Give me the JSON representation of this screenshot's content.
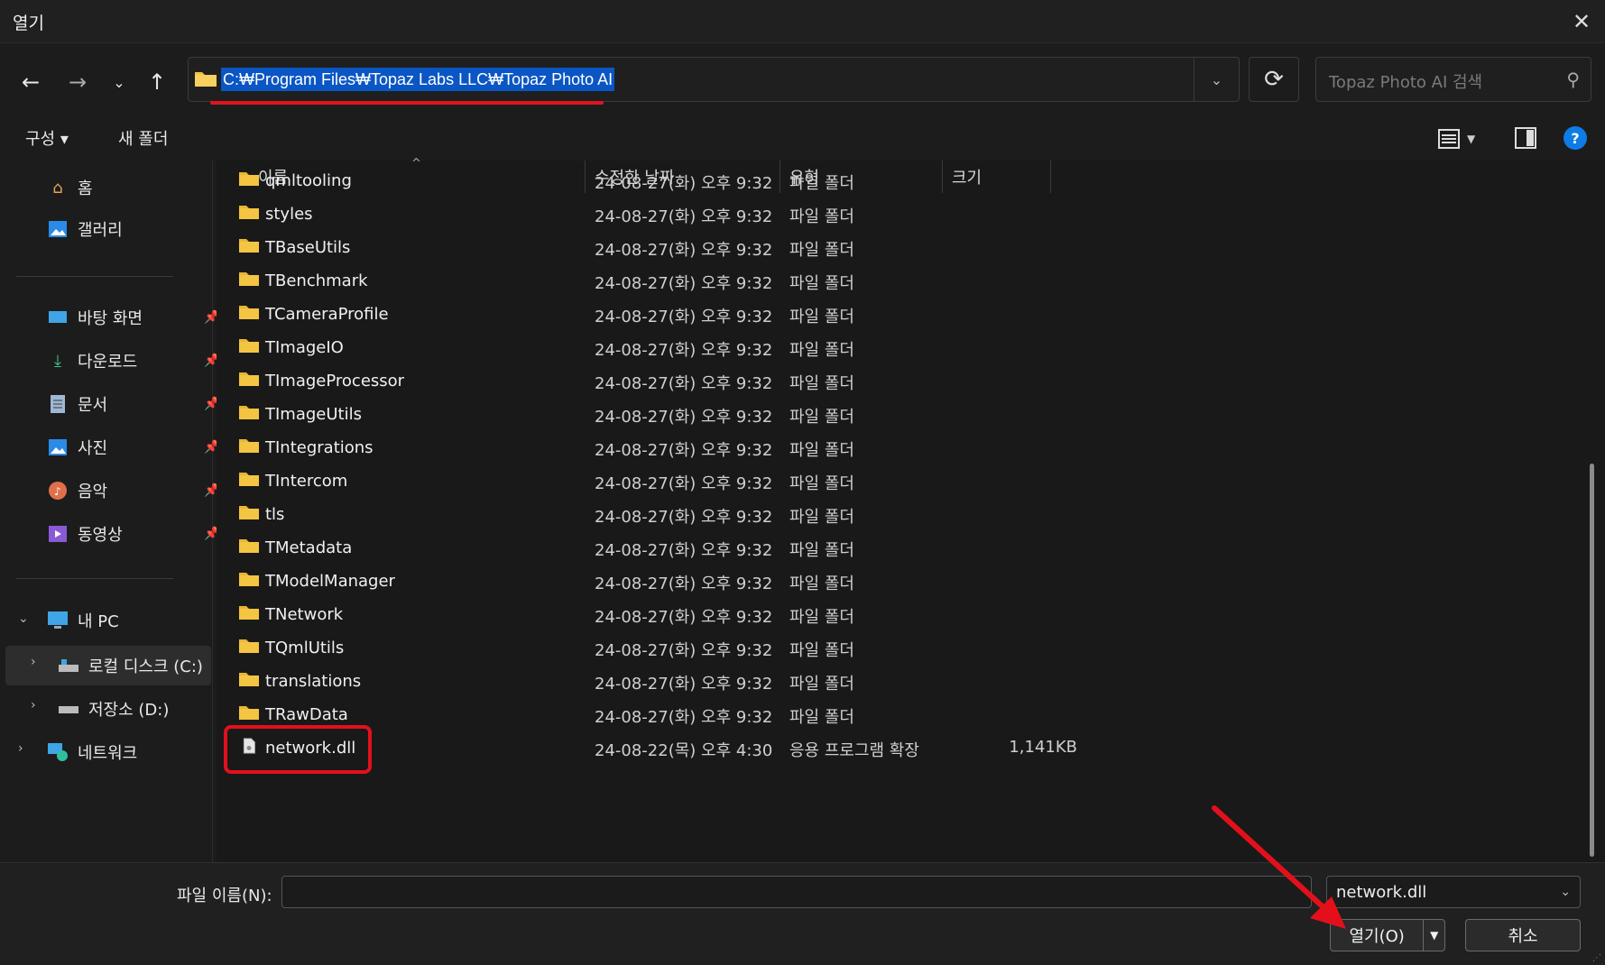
{
  "window": {
    "title": "열기"
  },
  "address": {
    "path": "C:₩Program Files₩Topaz Labs LLC₩Topaz Photo AI"
  },
  "search": {
    "placeholder": "Topaz Photo AI 검색"
  },
  "toolbar": {
    "organize_label": "구성 ▾",
    "new_folder_label": "새 폴더"
  },
  "sidebar": {
    "home": "홈",
    "gallery": "갤러리",
    "quick": [
      {
        "label": "바탕 화면"
      },
      {
        "label": "다운로드"
      },
      {
        "label": "문서"
      },
      {
        "label": "사진"
      },
      {
        "label": "음악"
      },
      {
        "label": "동영상"
      }
    ],
    "this_pc": "내 PC",
    "local_disk": "로컬 디스크 (C:)",
    "storage": "저장소 (D:)",
    "network": "네트워크"
  },
  "columns": {
    "name": "이름",
    "date": "수정한 날짜",
    "type": "유형",
    "size": "크기"
  },
  "files": [
    {
      "name": "qmltooling",
      "date": "24-08-27(화) 오후 9:32",
      "type": "파일 폴더",
      "size": ""
    },
    {
      "name": "styles",
      "date": "24-08-27(화) 오후 9:32",
      "type": "파일 폴더",
      "size": ""
    },
    {
      "name": "TBaseUtils",
      "date": "24-08-27(화) 오후 9:32",
      "type": "파일 폴더",
      "size": ""
    },
    {
      "name": "TBenchmark",
      "date": "24-08-27(화) 오후 9:32",
      "type": "파일 폴더",
      "size": ""
    },
    {
      "name": "TCameraProfile",
      "date": "24-08-27(화) 오후 9:32",
      "type": "파일 폴더",
      "size": ""
    },
    {
      "name": "TImageIO",
      "date": "24-08-27(화) 오후 9:32",
      "type": "파일 폴더",
      "size": ""
    },
    {
      "name": "TImageProcessor",
      "date": "24-08-27(화) 오후 9:32",
      "type": "파일 폴더",
      "size": ""
    },
    {
      "name": "TImageUtils",
      "date": "24-08-27(화) 오후 9:32",
      "type": "파일 폴더",
      "size": ""
    },
    {
      "name": "TIntegrations",
      "date": "24-08-27(화) 오후 9:32",
      "type": "파일 폴더",
      "size": ""
    },
    {
      "name": "TIntercom",
      "date": "24-08-27(화) 오후 9:32",
      "type": "파일 폴더",
      "size": ""
    },
    {
      "name": "tls",
      "date": "24-08-27(화) 오후 9:32",
      "type": "파일 폴더",
      "size": ""
    },
    {
      "name": "TMetadata",
      "date": "24-08-27(화) 오후 9:32",
      "type": "파일 폴더",
      "size": ""
    },
    {
      "name": "TModelManager",
      "date": "24-08-27(화) 오후 9:32",
      "type": "파일 폴더",
      "size": ""
    },
    {
      "name": "TNetwork",
      "date": "24-08-27(화) 오후 9:32",
      "type": "파일 폴더",
      "size": ""
    },
    {
      "name": "TQmlUtils",
      "date": "24-08-27(화) 오후 9:32",
      "type": "파일 폴더",
      "size": ""
    },
    {
      "name": "translations",
      "date": "24-08-27(화) 오후 9:32",
      "type": "파일 폴더",
      "size": ""
    },
    {
      "name": "TRawData",
      "date": "24-08-27(화) 오후 9:32",
      "type": "파일 폴더",
      "size": ""
    },
    {
      "name": "network.dll",
      "date": "24-08-22(목) 오후 4:30",
      "type": "응용 프로그램 확장",
      "size": "1,141KB",
      "kind": "file"
    }
  ],
  "bottom": {
    "filename_label": "파일 이름(N):",
    "filename_value": "",
    "filetype_value": "network.dll",
    "open_label": "열기(O)",
    "cancel_label": "취소"
  },
  "colors": {
    "accent": "#0a56c4",
    "highlight": "#e3101b",
    "folder": "#f4c542"
  }
}
